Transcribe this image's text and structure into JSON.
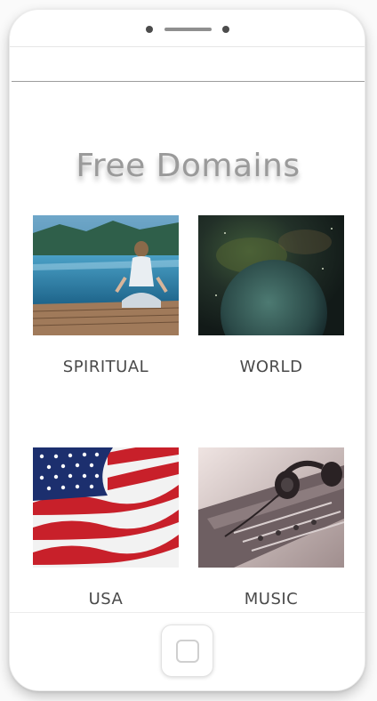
{
  "page": {
    "title": "Free Domains"
  },
  "tiles": [
    {
      "label": "SPIRITUAL",
      "image": "woman-meditating-on-dock-photo"
    },
    {
      "label": "WORLD",
      "image": "planet-in-space-photo"
    },
    {
      "label": "USA",
      "image": "american-flag-photo"
    },
    {
      "label": "MUSIC",
      "image": "headphones-on-mixing-console-photo"
    }
  ],
  "device": {
    "home_button": "home-button-icon"
  },
  "colors": {
    "title": "#9a9a9a",
    "label": "#4a4a4a"
  }
}
